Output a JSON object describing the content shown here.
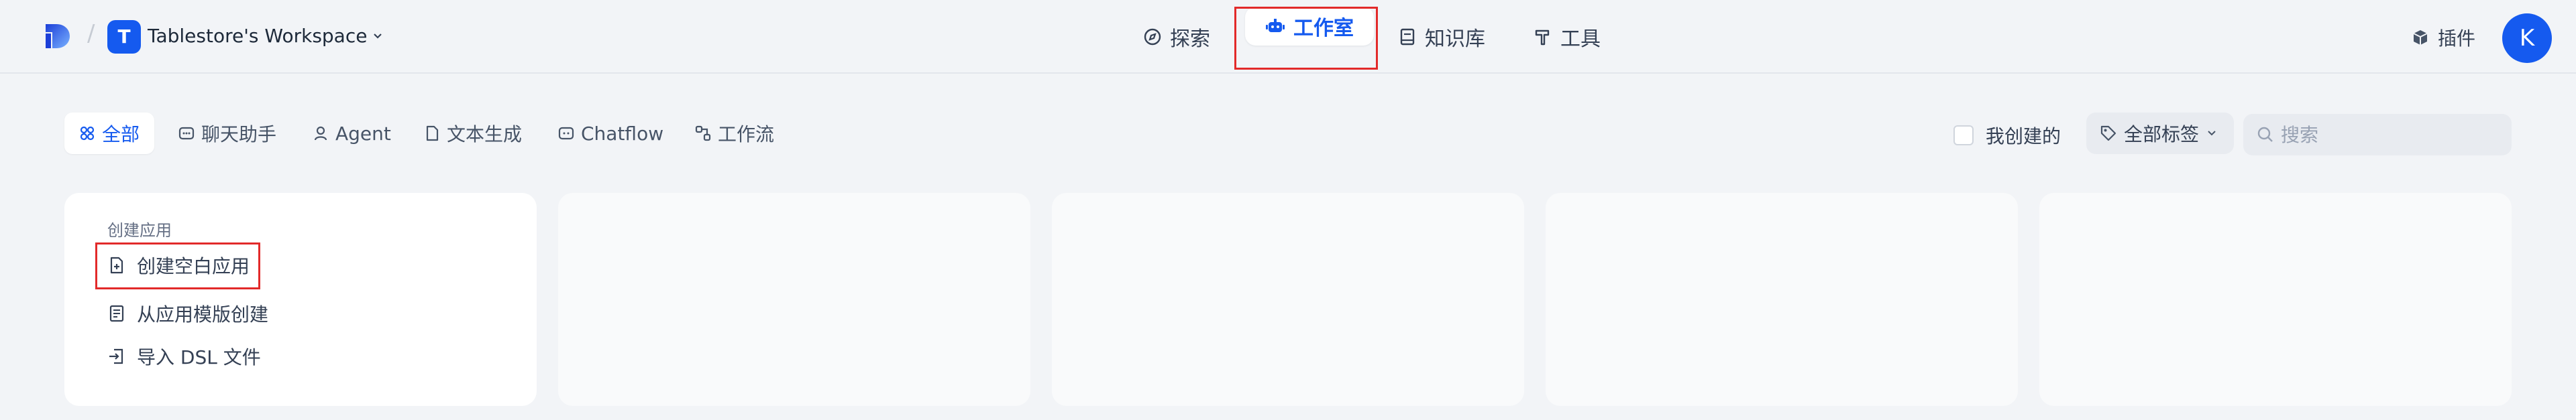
{
  "header": {
    "workspace": {
      "initial": "T",
      "name": "Tablestore's Workspace"
    },
    "nav": [
      {
        "label": "探索",
        "icon": "compass-icon"
      },
      {
        "label": "工作室",
        "icon": "robot-icon",
        "active": true
      },
      {
        "label": "知识库",
        "icon": "book-icon"
      },
      {
        "label": "工具",
        "icon": "hammer-icon"
      }
    ],
    "plugins_label": "插件",
    "user_initial": "K"
  },
  "filters": {
    "tabs": [
      {
        "label": "全部",
        "icon": "grid-icon",
        "active": true
      },
      {
        "label": "聊天助手",
        "icon": "chat-icon"
      },
      {
        "label": "Agent",
        "icon": "agent-icon"
      },
      {
        "label": "文本生成",
        "icon": "document-icon"
      },
      {
        "label": "Chatflow",
        "icon": "chatflow-icon"
      },
      {
        "label": "工作流",
        "icon": "workflow-icon"
      }
    ],
    "my_created_label": "我创建的",
    "tag_select_label": "全部标签",
    "search_placeholder": "搜索"
  },
  "create_card": {
    "title": "创建应用",
    "items": [
      {
        "label": "创建空白应用",
        "icon": "file-plus-icon"
      },
      {
        "label": "从应用模版创建",
        "icon": "template-icon"
      },
      {
        "label": "导入 DSL 文件",
        "icon": "import-icon"
      }
    ]
  },
  "colors": {
    "accent": "#155aef",
    "highlight": "#e22a2a",
    "background": "#f2f4f7"
  }
}
